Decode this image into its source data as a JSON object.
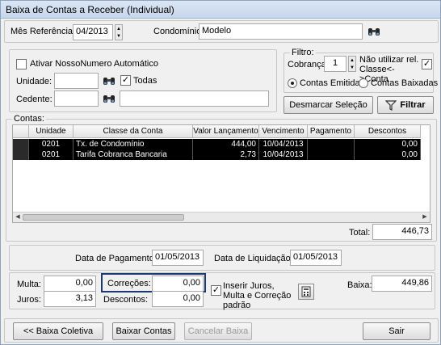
{
  "window": {
    "title": "Baixa de Contas a Receber (Individual)"
  },
  "header": {
    "mes_label": "Mês Referência:",
    "mes_value": "04/2013",
    "condominio_label": "Condomínio:",
    "condominio_value": "Modelo"
  },
  "options": {
    "nosso_numero_label": "Ativar NossoNumero Automático",
    "nosso_numero_checked": false,
    "unidade_label": "Unidade:",
    "unidade_value": "",
    "todas_label": "Todas",
    "todas_checked": true,
    "cedente_label": "Cedente:",
    "cedente_code": "",
    "cedente_name": ""
  },
  "filtro": {
    "legend": "Filtro:",
    "cobranca_label": "Cobrança:",
    "cobranca_value": "1",
    "nao_utilizar_label": "Não utilizar rel. Classe<->Conta",
    "nao_utilizar_checked": true,
    "radio_emitidas": "Contas Emitidas",
    "radio_baixadas": "Contas Baixadas",
    "selected": "emitidas"
  },
  "buttons": {
    "desmarcar": "Desmarcar Seleção",
    "filtrar": "Filtrar",
    "baixa_coletiva": "<< Baixa Coletiva",
    "baixar_contas": "Baixar Contas",
    "cancelar_baixa": "Cancelar Baixa",
    "sair": "Sair"
  },
  "contas": {
    "legend": "Contas:",
    "columns": [
      "Unidade",
      "Classe da Conta",
      "Valor Lançamento",
      "Vencimento",
      "Pagamento",
      "Descontos"
    ],
    "rows": [
      [
        "0201",
        "Tx. de Condomínio",
        "444,00",
        "10/04/2013",
        "",
        "0,00"
      ],
      [
        "0201",
        "Tarifa Cobranca Bancaria",
        "2,73",
        "10/04/2013",
        "",
        "0,00"
      ]
    ],
    "total_label": "Total:",
    "total_value": "446,73"
  },
  "datas": {
    "pagamento_label": "Data de Pagamento:",
    "pagamento_value": "01/05/2013",
    "liquidacao_label": "Data de Liquidação:",
    "liquidacao_value": "01/05/2013"
  },
  "valores": {
    "multa_label": "Multa:",
    "multa_value": "0,00",
    "juros_label": "Juros:",
    "juros_value": "3,13",
    "correcoes_label": "Correções:",
    "correcoes_value": "0,00",
    "descontos_label": "Descontos:",
    "descontos_value": "0,00",
    "inserir_label": "Inserir Juros, Multa e Correção padrão",
    "inserir_checked": true,
    "baixa_label": "Baixa:",
    "baixa_value": "449,86"
  },
  "icons": {
    "search": "binoculars-icon",
    "filter": "funnel-icon",
    "calc": "calculator-icon"
  },
  "colors": {
    "selected_row": "#000000",
    "highlight_border": "#1b3a6e",
    "titlebar": "#c7d7ec"
  }
}
